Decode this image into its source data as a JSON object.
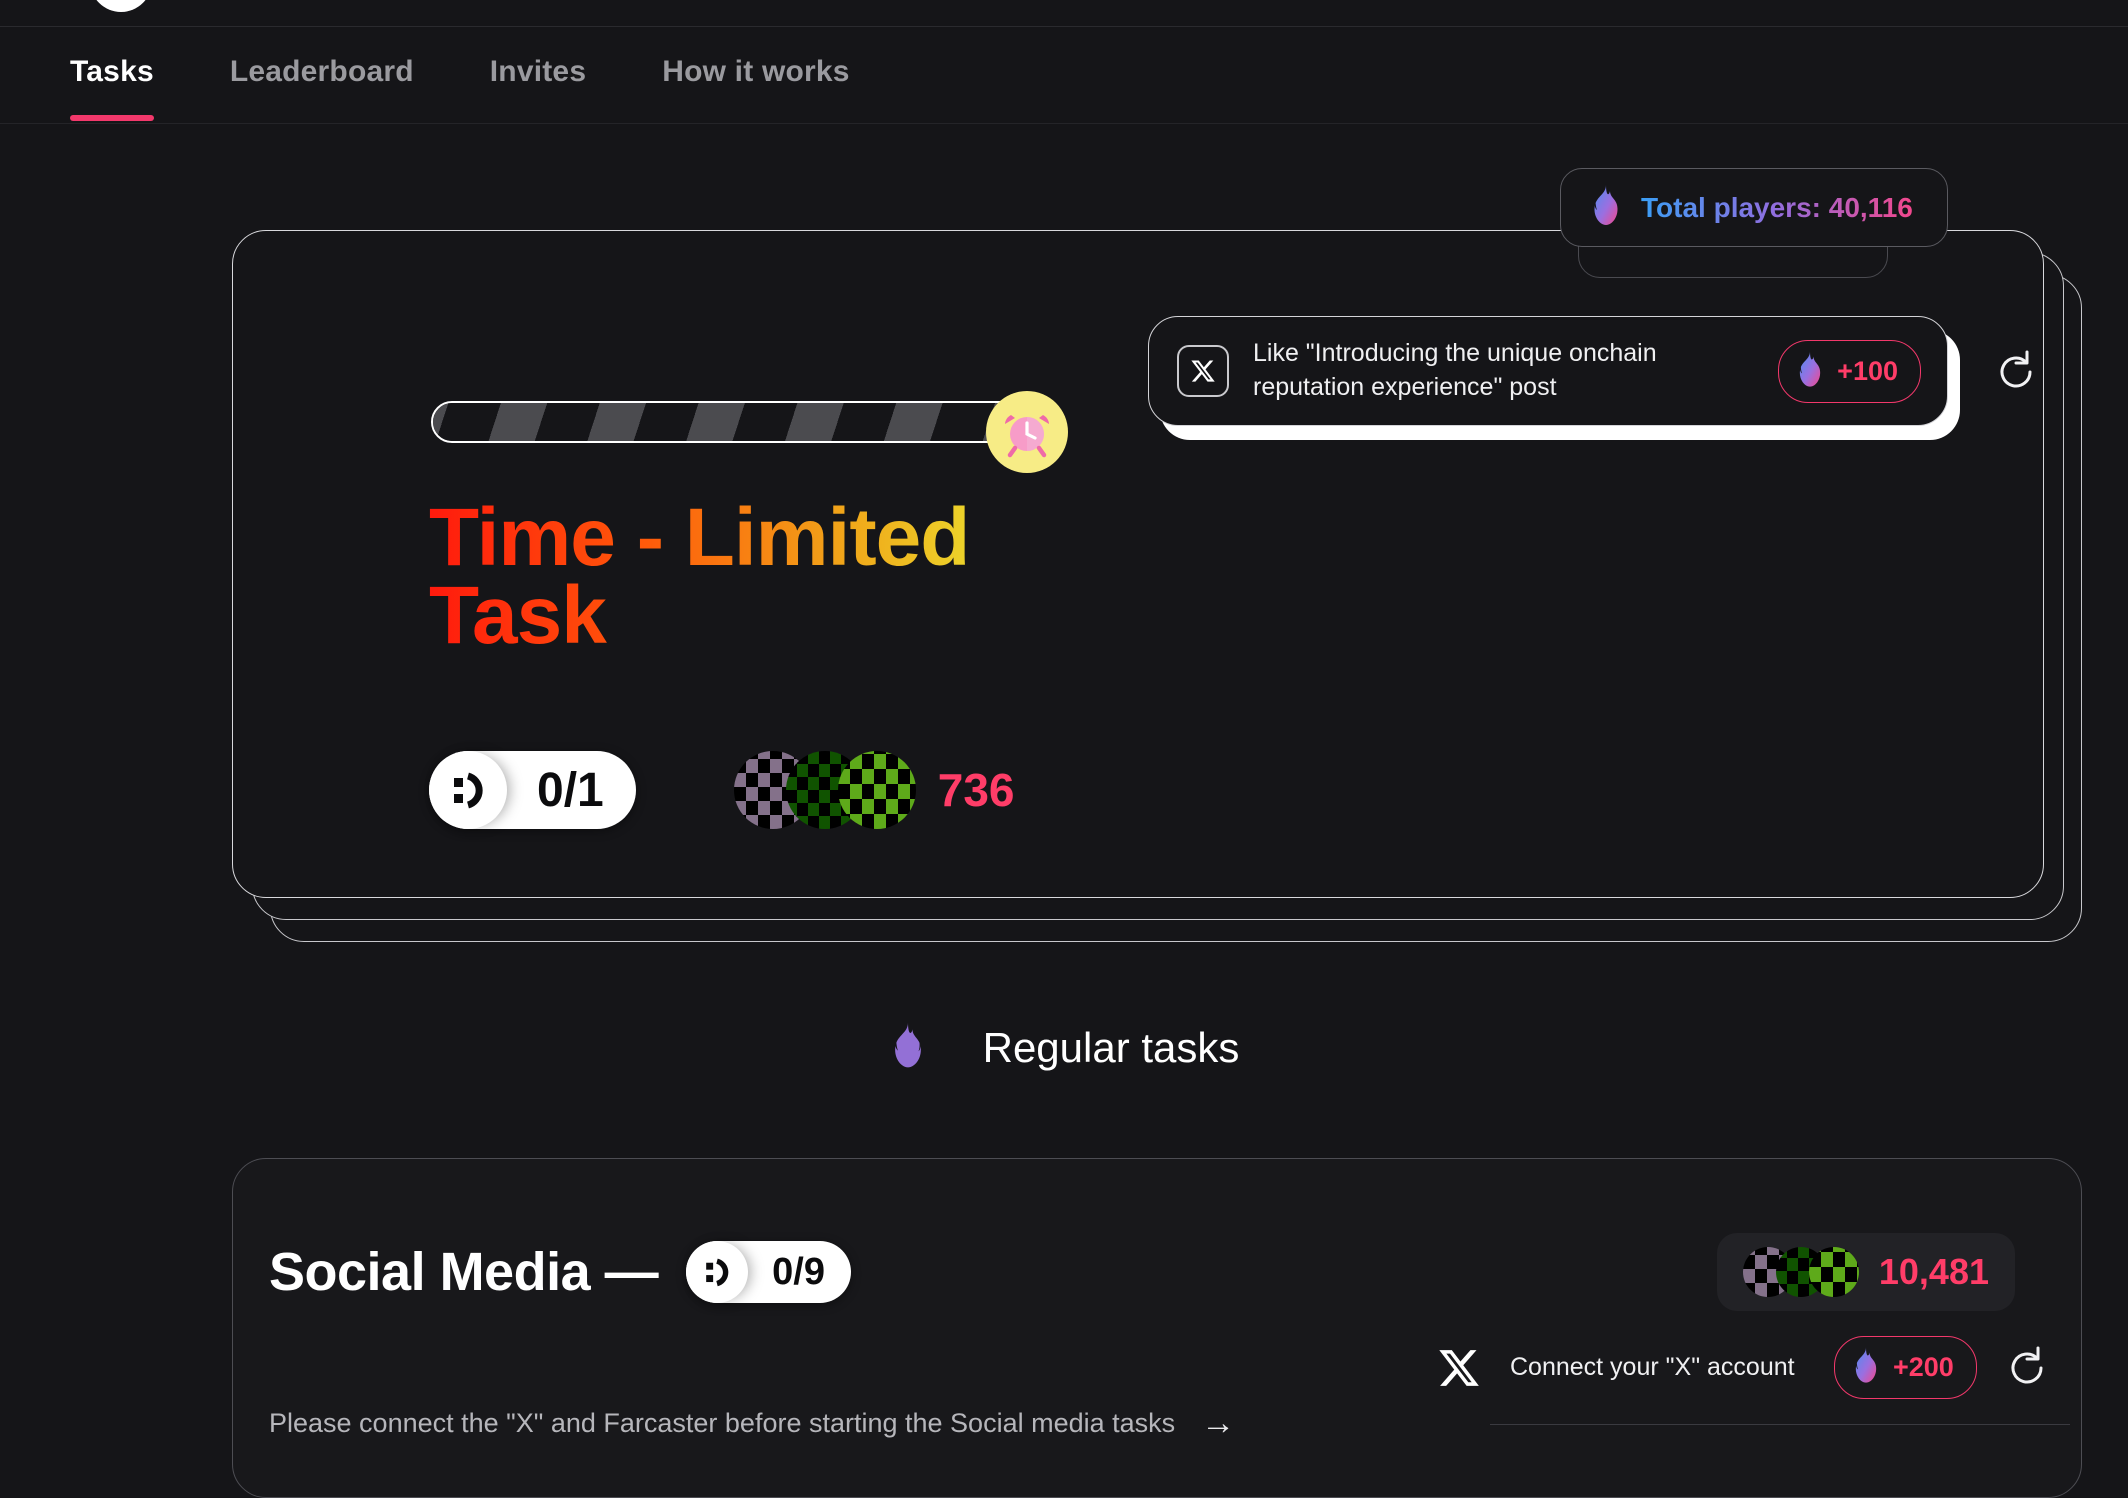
{
  "nav": {
    "items": [
      {
        "label": "Tasks",
        "active": true
      },
      {
        "label": "Leaderboard",
        "active": false
      },
      {
        "label": "Invites",
        "active": false
      },
      {
        "label": "How it works",
        "active": false
      }
    ]
  },
  "players_badge": {
    "icon": "flame-icon",
    "label": "Total players: 40,116"
  },
  "time_limited": {
    "title_line1": "Time - Limited",
    "title_line2": "Task",
    "clock_icon": "alarm-clock-icon",
    "progress_percent": 0,
    "counter": {
      "face_icon": "smiley-face-icon",
      "value": "0/1"
    },
    "participants": "736"
  },
  "featured_task": {
    "platform_icon": "x-logo-icon",
    "text": "Like \"Introducing the unique onchain reputation experience\" post",
    "reward": "+100",
    "reward_icon": "flame-icon",
    "refresh_icon": "refresh-icon"
  },
  "regular_section": {
    "icon": "flame-icon",
    "label": "Regular tasks"
  },
  "social_media": {
    "title": "Social Media —",
    "counter": {
      "face_icon": "smiley-face-icon",
      "value": "0/9"
    },
    "score": "10,481",
    "note": "Please connect the \"X\" and Farcaster before starting the Social media tasks",
    "note_arrow": "→"
  },
  "connect_task": {
    "platform_icon": "x-logo-icon",
    "text": "Connect your \"X\" account",
    "reward": "+200",
    "reward_icon": "flame-icon",
    "refresh_icon": "refresh-icon"
  },
  "colors": {
    "background": "#151518",
    "accent_pink": "#f2386b",
    "reward_text": "#ff3d68",
    "flame_purple": "#9370d6",
    "clock_bg": "#f7ec86"
  }
}
